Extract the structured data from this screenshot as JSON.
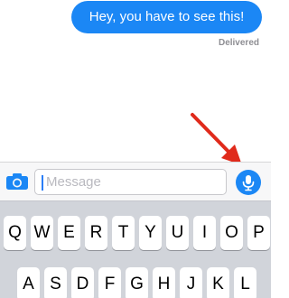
{
  "conversation": {
    "message_text": "Hey, you have to see this!",
    "message_status": "Delivered"
  },
  "composer": {
    "placeholder": "Message",
    "camera_icon": "camera-icon",
    "mic_icon": "microphone-icon"
  },
  "annotation": {
    "arrow_icon": "red-arrow-icon",
    "arrow_color": "#e02a1b"
  },
  "keyboard": {
    "row1": [
      "Q",
      "W",
      "E",
      "R",
      "T",
      "Y",
      "U",
      "I",
      "O",
      "P"
    ],
    "row2": [
      "A",
      "S",
      "D",
      "F",
      "G",
      "H",
      "J",
      "K",
      "L"
    ]
  },
  "colors": {
    "accent": "#1b87f5",
    "keyboard_bg": "#d1d4da"
  }
}
